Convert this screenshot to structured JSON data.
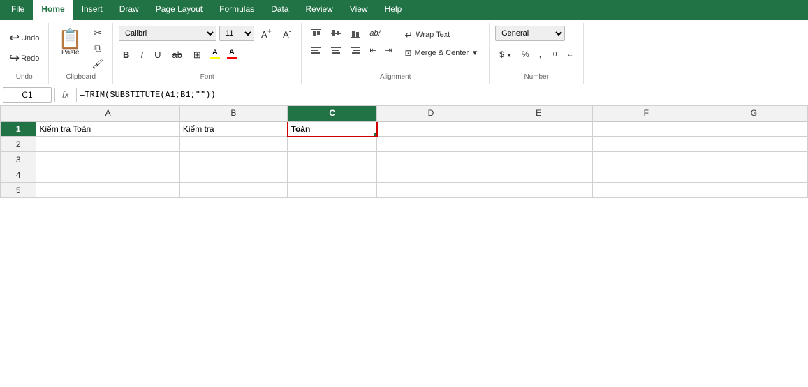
{
  "ribbon": {
    "tabs": [
      {
        "id": "file",
        "label": "File",
        "active": false
      },
      {
        "id": "home",
        "label": "Home",
        "active": true
      },
      {
        "id": "insert",
        "label": "Insert",
        "active": false
      },
      {
        "id": "draw",
        "label": "Draw",
        "active": false
      },
      {
        "id": "page-layout",
        "label": "Page Layout",
        "active": false
      },
      {
        "id": "formulas",
        "label": "Formulas",
        "active": false
      },
      {
        "id": "data",
        "label": "Data",
        "active": false
      },
      {
        "id": "review",
        "label": "Review",
        "active": false
      },
      {
        "id": "view",
        "label": "View",
        "active": false
      },
      {
        "id": "help",
        "label": "Help",
        "active": false
      }
    ],
    "groups": {
      "undo": {
        "label": "Undo",
        "undo_label": "Undo",
        "redo_label": "Redo"
      },
      "clipboard": {
        "label": "Clipboard",
        "paste_label": "Paste",
        "cut_icon": "✂",
        "copy_icon": "⧉",
        "format_painter_icon": "🖌"
      },
      "font": {
        "label": "Font",
        "font_name": "Calibri",
        "font_size": "11",
        "bold_label": "B",
        "italic_label": "I",
        "underline_label": "U",
        "strikethrough_label": "ab",
        "increase_size_label": "A↑",
        "decrease_size_label": "A↓",
        "borders_label": "⊞",
        "fill_label": "A",
        "fill_color": "#FFFF00",
        "font_color_label": "A",
        "font_color": "#FF0000"
      },
      "alignment": {
        "label": "Alignment",
        "align_top": "⬆",
        "align_mid": "↔",
        "align_bottom": "⬇",
        "align_left": "≡",
        "align_center": "☰",
        "align_right": "≡",
        "wrap_text_label": "Wrap Text",
        "merge_center_label": "Merge & Center",
        "indent_decrease": "⇤",
        "indent_increase": "⇥",
        "orientation": "ab/"
      },
      "number": {
        "label": "Number",
        "format": "General",
        "dollar_label": "$",
        "percent_label": "%",
        "comma_label": ",",
        "increase_decimal": "↑0",
        "decrease_decimal": "↓0"
      }
    }
  },
  "formula_bar": {
    "cell_ref": "C1",
    "formula": "=TRIM(SUBSTITUTE(A1;B1;\"\"))"
  },
  "spreadsheet": {
    "columns": [
      "A",
      "B",
      "C",
      "D",
      "E",
      "F",
      "G"
    ],
    "active_col": "C",
    "active_row": 1,
    "rows": [
      {
        "row_num": 1,
        "cells": [
          {
            "col": "A",
            "value": "Kiểm tra Toán"
          },
          {
            "col": "B",
            "value": "Kiểm tra"
          },
          {
            "col": "C",
            "value": "Toán",
            "active": true
          },
          {
            "col": "D",
            "value": ""
          },
          {
            "col": "E",
            "value": ""
          },
          {
            "col": "F",
            "value": ""
          },
          {
            "col": "G",
            "value": ""
          }
        ]
      },
      {
        "row_num": 2,
        "cells": [
          {
            "col": "A",
            "value": ""
          },
          {
            "col": "B",
            "value": ""
          },
          {
            "col": "C",
            "value": ""
          },
          {
            "col": "D",
            "value": ""
          },
          {
            "col": "E",
            "value": ""
          },
          {
            "col": "F",
            "value": ""
          },
          {
            "col": "G",
            "value": ""
          }
        ]
      },
      {
        "row_num": 3,
        "cells": [
          {
            "col": "A",
            "value": ""
          },
          {
            "col": "B",
            "value": ""
          },
          {
            "col": "C",
            "value": ""
          },
          {
            "col": "D",
            "value": ""
          },
          {
            "col": "E",
            "value": ""
          },
          {
            "col": "F",
            "value": ""
          },
          {
            "col": "G",
            "value": ""
          }
        ]
      },
      {
        "row_num": 4,
        "cells": [
          {
            "col": "A",
            "value": ""
          },
          {
            "col": "B",
            "value": ""
          },
          {
            "col": "C",
            "value": ""
          },
          {
            "col": "D",
            "value": ""
          },
          {
            "col": "E",
            "value": ""
          },
          {
            "col": "F",
            "value": ""
          },
          {
            "col": "G",
            "value": ""
          }
        ]
      },
      {
        "row_num": 5,
        "cells": [
          {
            "col": "A",
            "value": ""
          },
          {
            "col": "B",
            "value": ""
          },
          {
            "col": "C",
            "value": ""
          },
          {
            "col": "D",
            "value": ""
          },
          {
            "col": "E",
            "value": ""
          },
          {
            "col": "F",
            "value": ""
          },
          {
            "col": "G",
            "value": ""
          }
        ]
      }
    ]
  }
}
